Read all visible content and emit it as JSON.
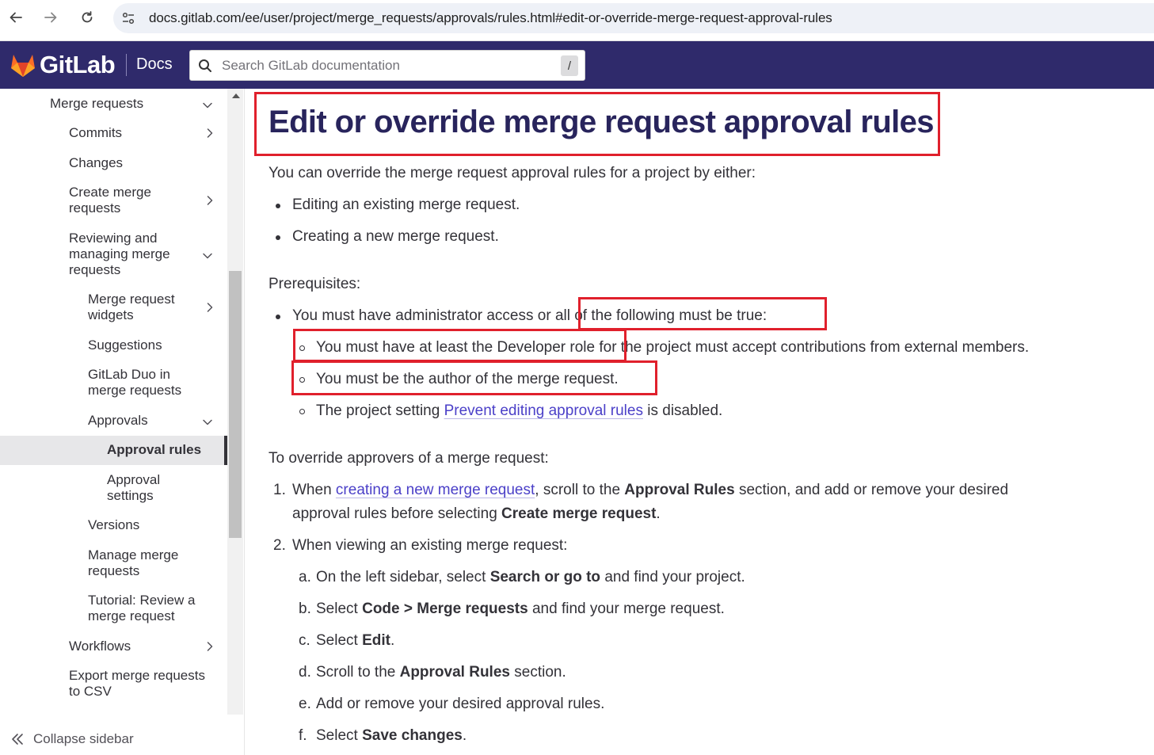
{
  "browser": {
    "url": "docs.gitlab.com/ee/user/project/merge_requests/approvals/rules.html#edit-or-override-merge-request-approval-rules"
  },
  "header": {
    "brand": "GitLab",
    "docs_label": "Docs",
    "search_placeholder": "Search GitLab documentation",
    "search_shortcut": "/"
  },
  "sidebar": {
    "items": [
      {
        "label_lines": [
          "Merge requests"
        ],
        "chevron": "down"
      },
      {
        "label_lines": [
          "Commits"
        ],
        "chevron": "right"
      },
      {
        "label_lines": [
          "Changes"
        ],
        "chevron": ""
      },
      {
        "label_lines": [
          "Create merge",
          "requests"
        ],
        "chevron": "right"
      },
      {
        "label_lines": [
          "Reviewing and",
          "managing merge",
          "requests"
        ],
        "chevron": "down"
      },
      {
        "label_lines": [
          "Merge request",
          "widgets"
        ],
        "chevron": "right"
      },
      {
        "label_lines": [
          "Suggestions"
        ],
        "chevron": ""
      },
      {
        "label_lines": [
          "GitLab Duo in",
          "merge requests"
        ],
        "chevron": ""
      },
      {
        "label_lines": [
          "Approvals"
        ],
        "chevron": "down"
      },
      {
        "label_lines": [
          "Approval rules"
        ],
        "chevron": "",
        "active": true
      },
      {
        "label_lines": [
          "Approval",
          "settings"
        ],
        "chevron": ""
      },
      {
        "label_lines": [
          "Versions"
        ],
        "chevron": ""
      },
      {
        "label_lines": [
          "Manage merge",
          "requests"
        ],
        "chevron": ""
      },
      {
        "label_lines": [
          "Tutorial: Review a",
          "merge request"
        ],
        "chevron": ""
      },
      {
        "label_lines": [
          "Workflows"
        ],
        "chevron": "right"
      },
      {
        "label_lines": [
          "Export merge requests",
          "to CSV"
        ],
        "chevron": ""
      }
    ],
    "collapse_label": "Collapse sidebar"
  },
  "content": {
    "title": "Edit or override merge request approval rules",
    "intro": "You can override the merge request approval rules for a project by either:",
    "intro_bullets": [
      "Editing an existing merge request.",
      "Creating a new merge request."
    ],
    "prereq_heading": "Prerequisites:",
    "prereq_main_a": "You must have administrator access or ",
    "prereq_main_b": "all of the following must be true:",
    "prereq_sub_1a": "You must have at least the Developer role",
    "prereq_sub_1b": " for the project must accept contributions from external members.",
    "prereq_sub_2": "You must be the author of the merge request.",
    "prereq_sub_3a": "The project setting ",
    "prereq_sub_3_link": "Prevent editing approval rules",
    "prereq_sub_3b": " is disabled.",
    "override_heading": "To override approvers of a merge request:",
    "step1_num": "1.",
    "step1_a": "When ",
    "step1_link": "creating a new merge request",
    "step1_b": ", scroll to the ",
    "step1_bold1": "Approval Rules",
    "step1_c": " section, and add or remove your desired",
    "step1_d": "approval rules before selecting ",
    "step1_bold2": "Create merge request",
    "step1_e": ".",
    "step2_num": "2.",
    "step2": "When viewing an existing merge request:",
    "substeps": [
      {
        "letter": "a.",
        "a": "On the left sidebar, select ",
        "bold": "Search or go to",
        "b": " and find your project."
      },
      {
        "letter": "b.",
        "a": "Select ",
        "bold": "Code > Merge requests",
        "b": " and find your merge request."
      },
      {
        "letter": "c.",
        "a": "Select ",
        "bold": "Edit",
        "b": "."
      },
      {
        "letter": "d.",
        "a": "Scroll to the ",
        "bold": "Approval Rules",
        "b": " section."
      },
      {
        "letter": "e.",
        "a": "Add or remove your desired approval rules.",
        "bold": "",
        "b": ""
      },
      {
        "letter": "f.",
        "a": "Select ",
        "bold": "Save changes",
        "b": "."
      }
    ]
  },
  "colors": {
    "header_bg": "#2f2a6b",
    "title_color": "#28245c",
    "link_color": "#4b40c8",
    "highlight_red": "#e0202c"
  },
  "icons": [
    "back-arrow-icon",
    "forward-arrow-icon",
    "reload-icon",
    "site-info-icon",
    "gitlab-tanuki-logo-icon",
    "search-icon",
    "chevron-down-icon",
    "chevron-right-icon",
    "double-chevron-left-icon"
  ]
}
